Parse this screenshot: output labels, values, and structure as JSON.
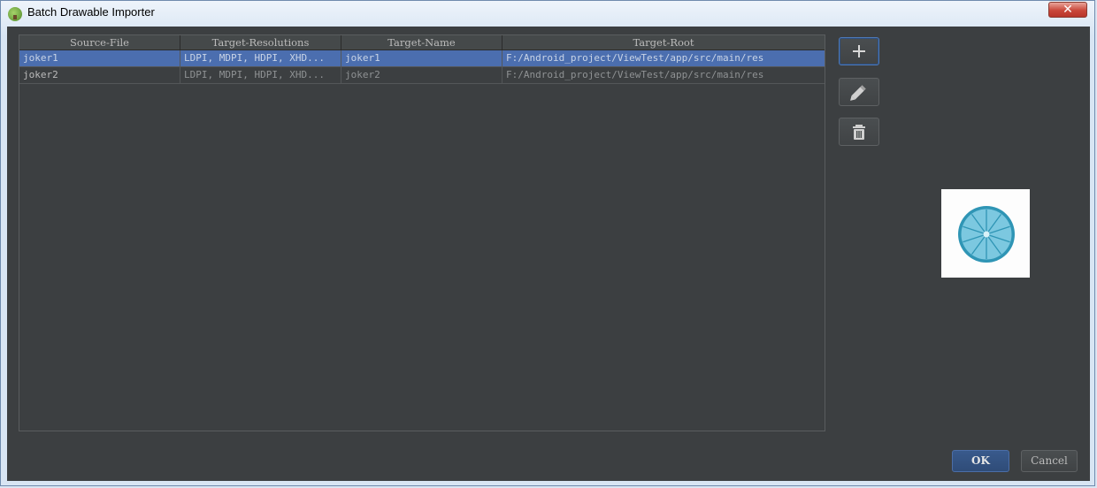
{
  "window": {
    "title": "Batch Drawable Importer",
    "close_glyph": "✕"
  },
  "table": {
    "columns": [
      "Source-File",
      "Target-Resolutions",
      "Target-Name",
      "Target-Root"
    ],
    "rows": [
      {
        "source": "joker1",
        "resolutions": "LDPI, MDPI, HDPI, XHD...",
        "name": "joker1",
        "root": "F:/Android_project/ViewTest/app/src/main/res",
        "selected": true
      },
      {
        "source": "joker2",
        "resolutions": "LDPI, MDPI, HDPI, XHD...",
        "name": "joker2",
        "root": "F:/Android_project/ViewTest/app/src/main/res",
        "selected": false
      }
    ]
  },
  "side_buttons": [
    {
      "icon": "plus-icon"
    },
    {
      "icon": "pencil-icon"
    },
    {
      "icon": "trash-icon"
    }
  ],
  "preview": {
    "image": "lime-slice-image",
    "color": "#3fa9c9"
  },
  "footer": {
    "ok_label": "OK",
    "cancel_label": "Cancel"
  },
  "colors": {
    "background": "#3c3f41",
    "selection": "#4b6eaf",
    "ok_button": "#365880"
  }
}
